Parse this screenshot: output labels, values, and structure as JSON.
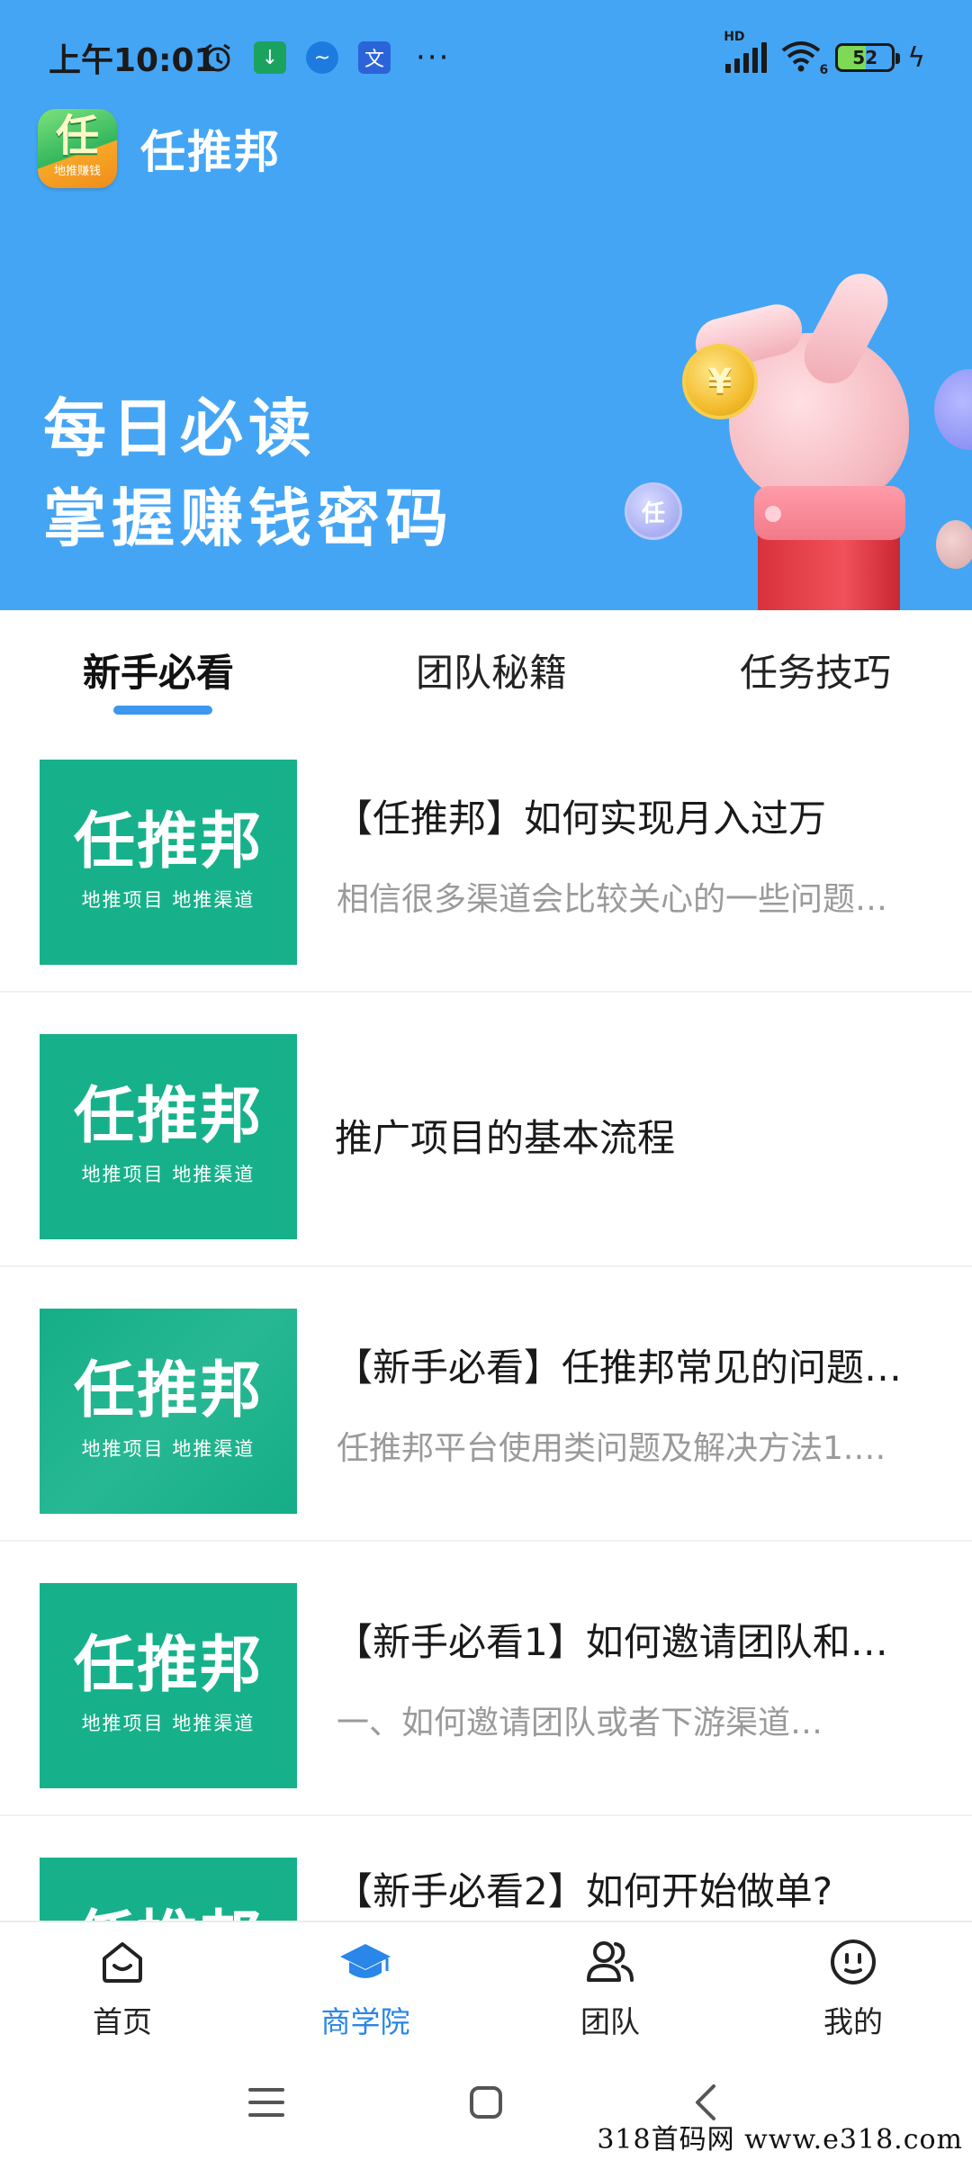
{
  "status_bar": {
    "time": "上午10:01",
    "dots": "···",
    "battery": "52",
    "net_tag": "HD",
    "wifi_tag": "6"
  },
  "app": {
    "title": "任推邦",
    "logo_glyph": "任",
    "logo_tag": "地推赚钱"
  },
  "banner": {
    "line1": "每日必读",
    "line2": "掌握赚钱密码",
    "coin_symbol": "¥",
    "small_coin_glyph": "任"
  },
  "tabs": [
    {
      "label": "新手必看",
      "active": true
    },
    {
      "label": "团队秘籍",
      "active": false
    },
    {
      "label": "任务技巧",
      "active": false
    }
  ],
  "thumb": {
    "brand": "任推邦",
    "sub": "地推项目  地推渠道"
  },
  "articles": [
    {
      "title": "【任推邦】如何实现月入过万",
      "desc": "相信很多渠道会比较关心的一些问题…"
    },
    {
      "title": "推广项目的基本流程",
      "desc": ""
    },
    {
      "title": "【新手必看】任推邦常见的问题…",
      "desc": "任推邦平台使用类问题及解决方法1.…"
    },
    {
      "title": "【新手必看1】如何邀请团队和…",
      "desc": "一、如何邀请团队或者下游渠道…"
    },
    {
      "title": "【新手必看2】如何开始做单?",
      "desc": ""
    }
  ],
  "bottom_nav": [
    {
      "label": "首页",
      "icon": "home-icon",
      "active": false
    },
    {
      "label": "商学院",
      "icon": "graduation-cap-icon",
      "active": true
    },
    {
      "label": "团队",
      "icon": "team-icon",
      "active": false
    },
    {
      "label": "我的",
      "icon": "smiley-face-icon",
      "active": false
    }
  ],
  "colors": {
    "hero_bg": "#44a5f5",
    "accent": "#2a86e8",
    "thumb_green": "#16b18a"
  },
  "watermark": "318首码网  www.e318.com"
}
